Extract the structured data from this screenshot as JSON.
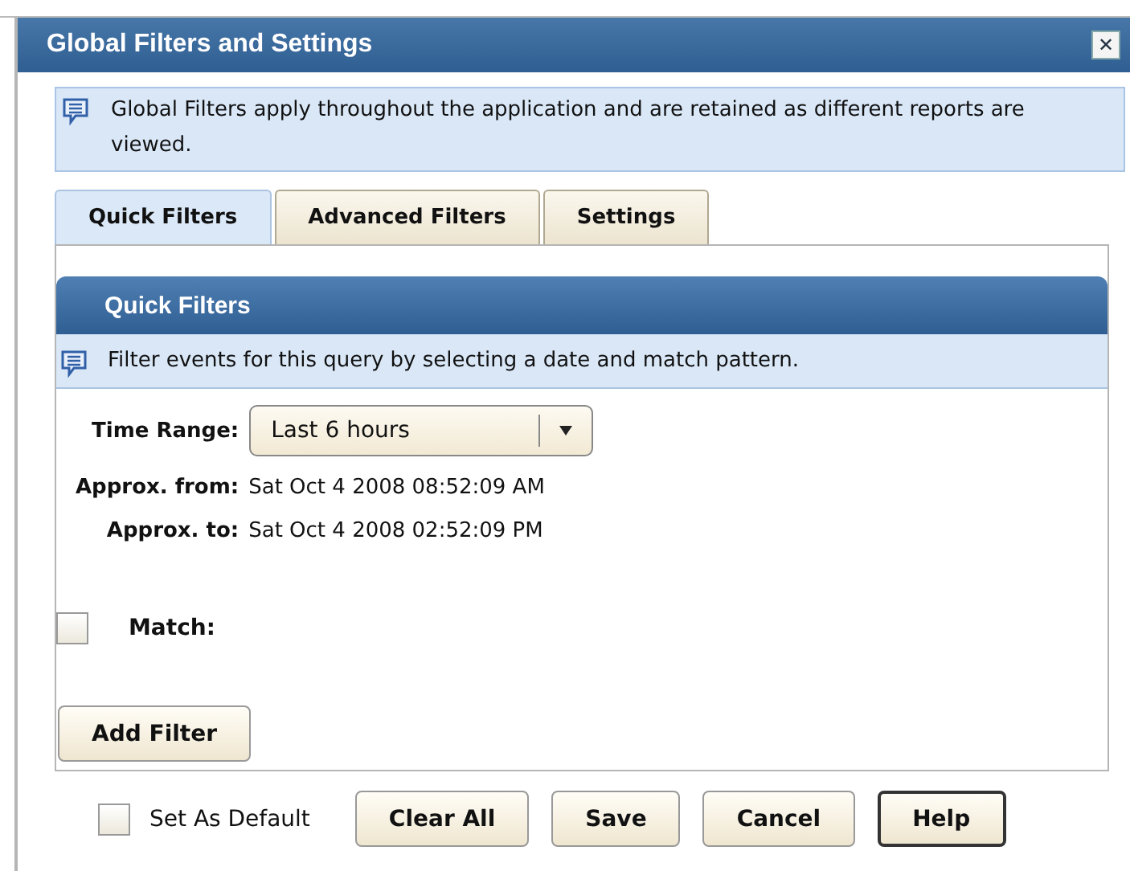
{
  "window": {
    "title": "Global Filters and Settings",
    "close": "✕"
  },
  "notice": "Global Filters apply throughout the application and are retained as different reports are viewed.",
  "tabs": [
    {
      "label": "Quick Filters",
      "selected": true
    },
    {
      "label": "Advanced Filters",
      "selected": false
    },
    {
      "label": "Settings",
      "selected": false
    }
  ],
  "panel": {
    "title": "Quick Filters",
    "hint": "Filter events for this query by selecting a date and match pattern.",
    "time_range": {
      "label": "Time Range:",
      "value": "Last 6 hours"
    },
    "fields": [
      {
        "label": "Approx. from:",
        "value": "Sat Oct 4 2008 08:52:09 AM"
      },
      {
        "label": "Approx. to:",
        "value": "Sat Oct 4 2008 02:52:09 PM"
      }
    ],
    "match": {
      "label": "Match:",
      "checked": false
    },
    "add_button": "Add Filter"
  },
  "footer": {
    "default": {
      "label": "Set As Default",
      "checked": false
    },
    "buttons": [
      {
        "label": "Clear All",
        "focused": false
      },
      {
        "label": "Save",
        "focused": false
      },
      {
        "label": "Cancel",
        "focused": false
      },
      {
        "label": "Help",
        "focused": true
      }
    ]
  }
}
